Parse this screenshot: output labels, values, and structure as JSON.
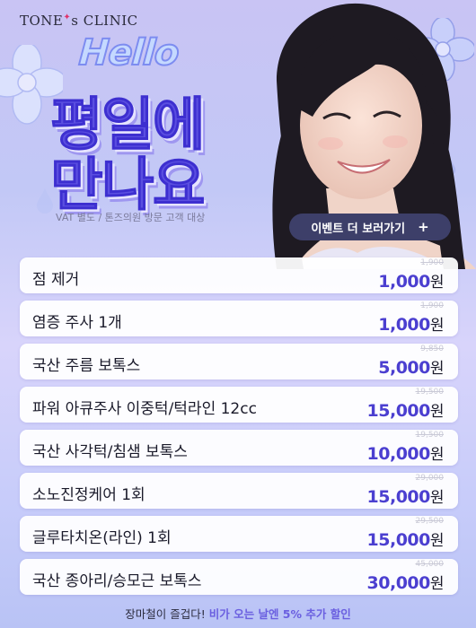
{
  "brand": {
    "name_part1": "TONE",
    "star": "✦",
    "name_part2": "s CLINIC"
  },
  "hero": {
    "greeting": "Hello",
    "headline_line1": "평일에",
    "headline_line2": "만나요",
    "note": "VAT 별도 / 톤즈의원 방문 고객 대상"
  },
  "event_button": {
    "label": "이벤트 더 보러가기",
    "icon": "plus-icon",
    "plus": "+"
  },
  "price_list": [
    {
      "name": "점 제거",
      "original": "1,900",
      "price": "1,000",
      "unit": "원"
    },
    {
      "name": "염증 주사 1개",
      "original": "1,900",
      "price": "1,000",
      "unit": "원"
    },
    {
      "name": "국산 주름 보톡스",
      "original": "9,850",
      "price": "5,000",
      "unit": "원"
    },
    {
      "name": "파워 아큐주사 이중턱/턱라인 12cc",
      "original": "19,500",
      "price": "15,000",
      "unit": "원"
    },
    {
      "name": "국산 사각턱/침샘 보톡스",
      "original": "19,500",
      "price": "10,000",
      "unit": "원"
    },
    {
      "name": "소노진정케어 1회",
      "original": "29,000",
      "price": "15,000",
      "unit": "원"
    },
    {
      "name": "글루타치온(라인) 1회",
      "original": "29,500",
      "price": "15,000",
      "unit": "원"
    },
    {
      "name": "국산 종아리/승모근 보톡스",
      "original": "45,000",
      "price": "30,000",
      "unit": "원"
    }
  ],
  "footer": {
    "prefix": "장마철이 즐겁다! ",
    "highlight": "비가 오는 날엔 5% 추가 할인"
  },
  "colors": {
    "accent": "#4b3fd0",
    "headline": "#5b4fe0",
    "button_bg": "#3d3f69",
    "bg": "#c9c4f4"
  }
}
